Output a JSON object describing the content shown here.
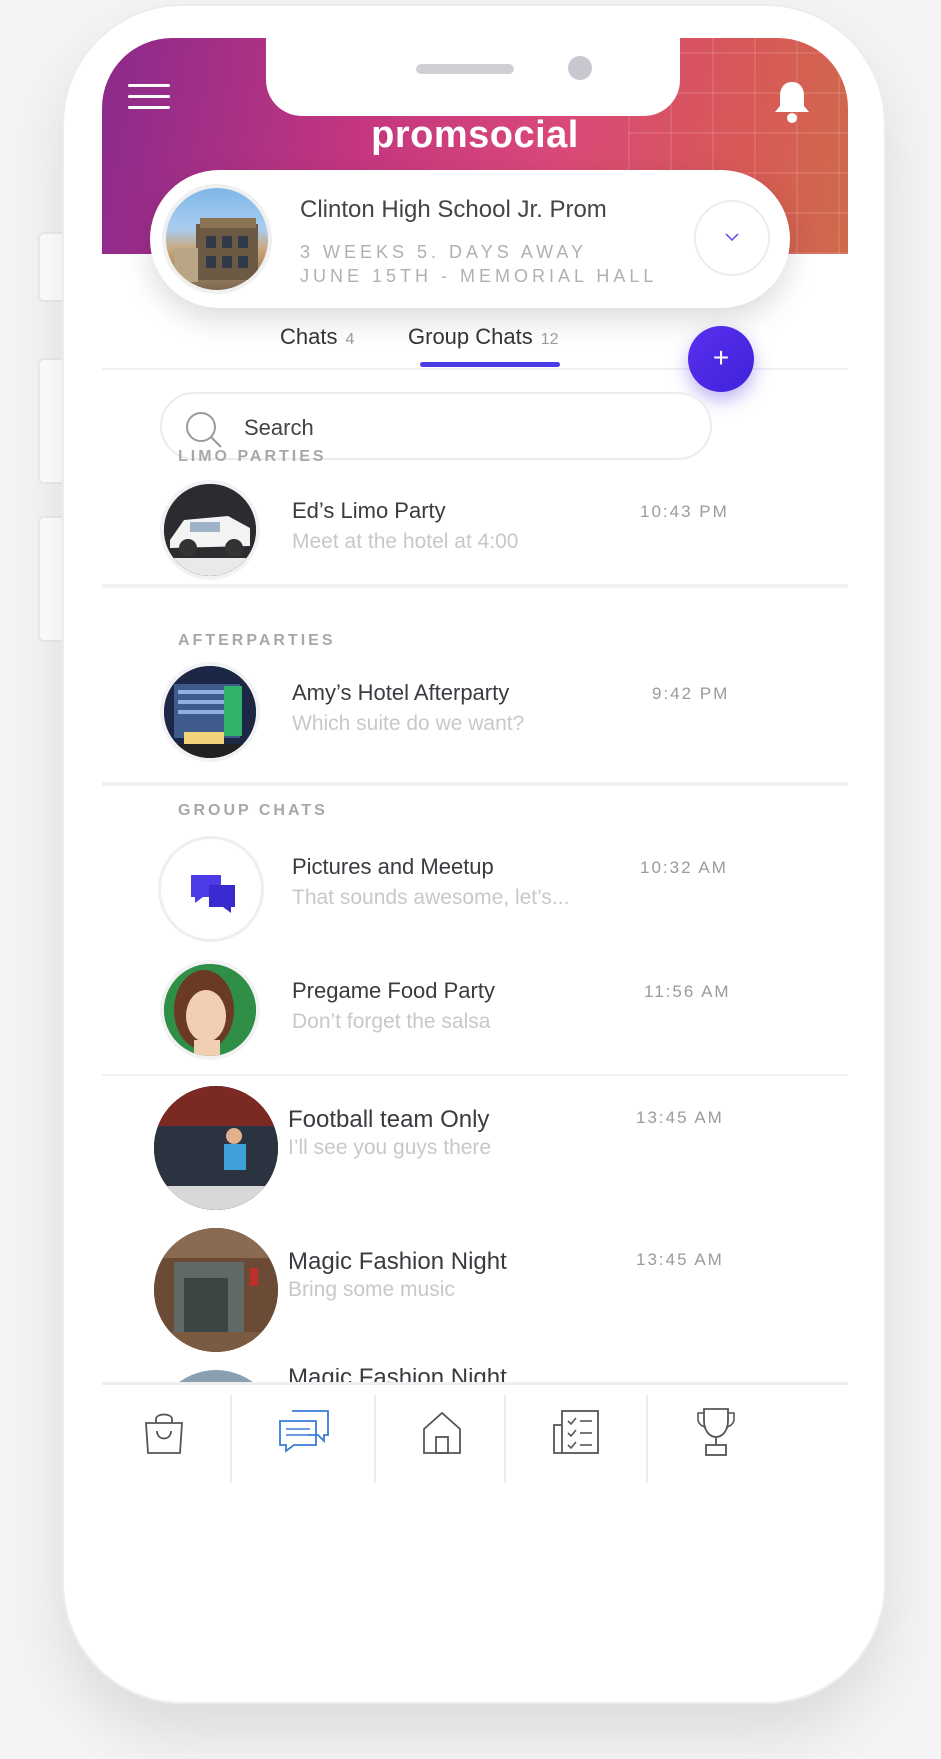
{
  "app": {
    "logo": "promsocial"
  },
  "event": {
    "title": "Clinton High School Jr. Prom",
    "countdown": "3 WEEKS  5. DAYS AWAY",
    "details": "JUNE 15TH -  MEMORIAL  HALL"
  },
  "tabs": [
    {
      "label": "Chats",
      "count": "4"
    },
    {
      "label": "Group Chats",
      "count": "12",
      "active": true
    }
  ],
  "fab": {
    "label": "+"
  },
  "search": {
    "placeholder": "Search"
  },
  "sections": {
    "limo": "LIMO PARTIES",
    "afterparties": "AFTERPARTIES",
    "group": "GROUP CHATS"
  },
  "chats": [
    {
      "title": "Ed’s Limo Party",
      "message": "Meet at the hotel at 4:00",
      "time": "10:43 PM"
    },
    {
      "title": "Amy’s Hotel Afterparty",
      "message": "Which suite do we want?",
      "time": "9:42 PM"
    },
    {
      "title": "Pictures and Meetup",
      "message": "That sounds awesome, let’s...",
      "time": "10:32 AM"
    },
    {
      "title": "Pregame Food Party",
      "message": "Don’t forget the salsa",
      "time": "11:56 AM"
    },
    {
      "title": "Football team Only",
      "message": "I’ll see you guys there",
      "time": "13:45 AM"
    },
    {
      "title": "Magic Fashion Night",
      "message": "Bring some music",
      "time": "13:45 AM"
    },
    {
      "title": "Magic Fashion Night",
      "message": "",
      "time": ""
    }
  ],
  "bottom_nav": [
    {
      "icon": "shopping-bag-icon"
    },
    {
      "icon": "chat-bubbles-icon",
      "active": true
    },
    {
      "icon": "home-icon"
    },
    {
      "icon": "checklist-icon"
    },
    {
      "icon": "trophy-icon"
    }
  ],
  "colors": {
    "accent": "#4b3ce8",
    "active_nav": "#3a7bd5",
    "header_start": "#8a2a8c",
    "header_end": "#cf6a4c"
  }
}
